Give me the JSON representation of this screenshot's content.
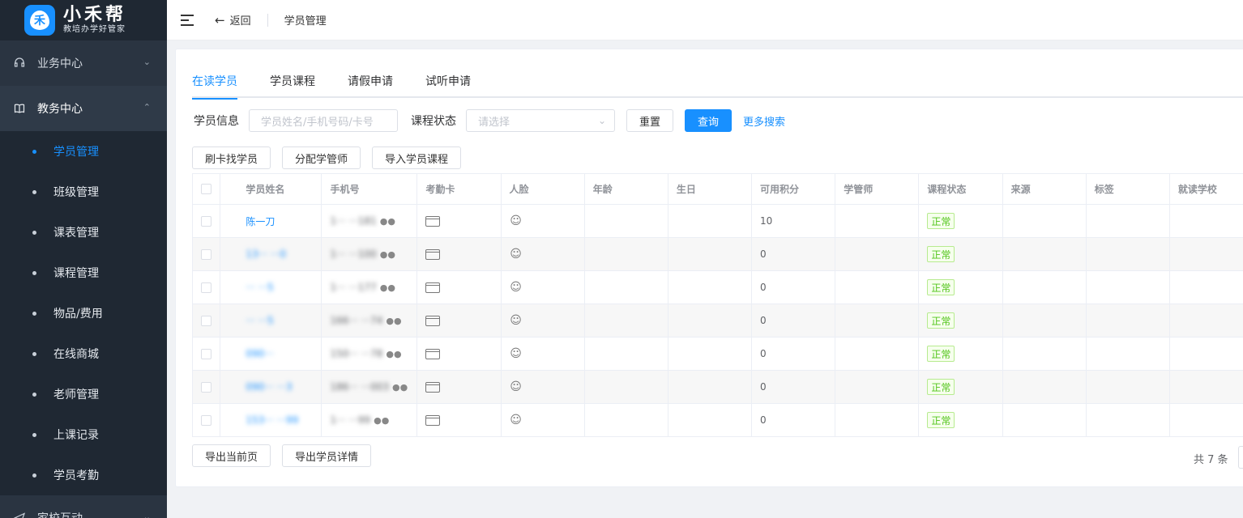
{
  "brand": {
    "title": "小禾帮",
    "subtitle": "教培办学好管家",
    "logo_glyph": "禾",
    "accent": "#1890ff"
  },
  "sidebar": {
    "groups": [
      {
        "label": "业务中心",
        "icon": "headset-icon",
        "expanded": false
      },
      {
        "label": "教务中心",
        "icon": "book-icon",
        "expanded": true
      },
      {
        "label": "家校互动",
        "icon": "send-icon",
        "expanded": false
      }
    ],
    "items": [
      "学员管理",
      "班级管理",
      "课表管理",
      "课程管理",
      "物品/费用",
      "在线商城",
      "老师管理",
      "上课记录",
      "学员考勤"
    ],
    "active_item": "学员管理"
  },
  "topbar": {
    "back_label": "返回",
    "breadcrumb": "学员管理"
  },
  "tabs": [
    "在读学员",
    "学员课程",
    "请假申请",
    "试听申请"
  ],
  "filters": {
    "student_label": "学员信息",
    "student_placeholder": "学员姓名/手机号码/卡号",
    "status_label": "课程状态",
    "status_placeholder": "请选择",
    "reset_label": "重置",
    "query_label": "查询",
    "more_label": "更多搜索"
  },
  "actions": [
    "刷卡找学员",
    "分配学管师",
    "导入学员课程"
  ],
  "table": {
    "columns": [
      "学员姓名",
      "手机号",
      "考勤卡",
      "人脸",
      "年龄",
      "生日",
      "可用积分",
      "学管师",
      "课程状态",
      "来源",
      "标签",
      "就读学校"
    ],
    "rows": [
      {
        "name": "陈一刀",
        "phone": "1··· ···181",
        "points": "10",
        "status": "正常"
      },
      {
        "name": "13··· ···0",
        "phone": "1··· ···100",
        "points": "0",
        "status": "正常"
      },
      {
        "name": "··· ···5",
        "phone": "1··· ···177",
        "points": "0",
        "status": "正常"
      },
      {
        "name": "··· ···5",
        "phone": "166··· ···74",
        "points": "0",
        "status": "正常"
      },
      {
        "name": "090···",
        "phone": "150··· ···78",
        "points": "0",
        "status": "正常"
      },
      {
        "name": "090··· ···3",
        "phone": "186··· ···003",
        "points": "0",
        "status": "正常"
      },
      {
        "name": "153··· ···99",
        "phone": "1··· ···99",
        "points": "0",
        "status": "正常"
      }
    ]
  },
  "bottom": {
    "export_page": "导出当前页",
    "export_details": "导出学员详情",
    "total": "共 7 条"
  }
}
